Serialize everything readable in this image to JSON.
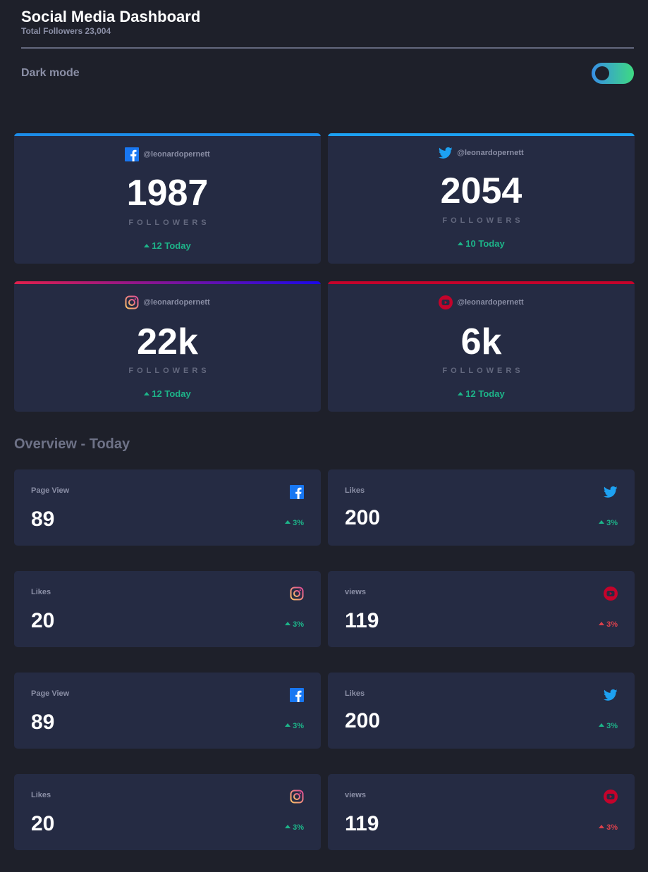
{
  "header": {
    "title": "Social Media Dashboard",
    "subtitle": "Total Followers 23,004"
  },
  "dark_mode": {
    "label": "Dark mode",
    "enabled": true
  },
  "colors": {
    "facebook": "#1877f2",
    "twitter": "#1da1f2",
    "instagram_start": "#e0204c",
    "instagram_end": "#1a08e8",
    "youtube": "#c4032b",
    "positive": "#1db489",
    "negative": "#dc414c"
  },
  "followers": [
    {
      "network": "facebook",
      "icon": "facebook-icon",
      "handle": "@leonardopernett",
      "count": "1987",
      "label": "FOLLOWERS",
      "change": "12 Today",
      "direction": "up"
    },
    {
      "network": "twitter",
      "icon": "twitter-icon",
      "handle": "@leonardopernett",
      "count": "2054",
      "label": "FOLLOWERS",
      "change": "10 Today",
      "direction": "up"
    },
    {
      "network": "instagram",
      "icon": "instagram-icon",
      "handle": "@leonardopernett",
      "count": "22k",
      "label": "FOLLOWERS",
      "change": "12 Today",
      "direction": "up"
    },
    {
      "network": "youtube",
      "icon": "youtube-icon",
      "handle": "@leonardopernett",
      "count": "6k",
      "label": "FOLLOWERS",
      "change": "12 Today",
      "direction": "up"
    }
  ],
  "overview": {
    "title": "Overview - Today",
    "cards": [
      {
        "label": "Page View",
        "icon": "facebook-icon",
        "value": "89",
        "change": "3%",
        "direction": "up"
      },
      {
        "label": "Likes",
        "icon": "twitter-icon",
        "value": "200",
        "change": "3%",
        "direction": "up"
      },
      {
        "label": "Likes",
        "icon": "instagram-icon",
        "value": "20",
        "change": "3%",
        "direction": "up"
      },
      {
        "label": "views",
        "icon": "youtube-icon",
        "value": "119",
        "change": "3%",
        "direction": "down"
      },
      {
        "label": "Page View",
        "icon": "facebook-icon",
        "value": "89",
        "change": "3%",
        "direction": "up"
      },
      {
        "label": "Likes",
        "icon": "twitter-icon",
        "value": "200",
        "change": "3%",
        "direction": "up"
      },
      {
        "label": "Likes",
        "icon": "instagram-icon",
        "value": "20",
        "change": "3%",
        "direction": "up"
      },
      {
        "label": "views",
        "icon": "youtube-icon",
        "value": "119",
        "change": "3%",
        "direction": "down"
      }
    ]
  }
}
